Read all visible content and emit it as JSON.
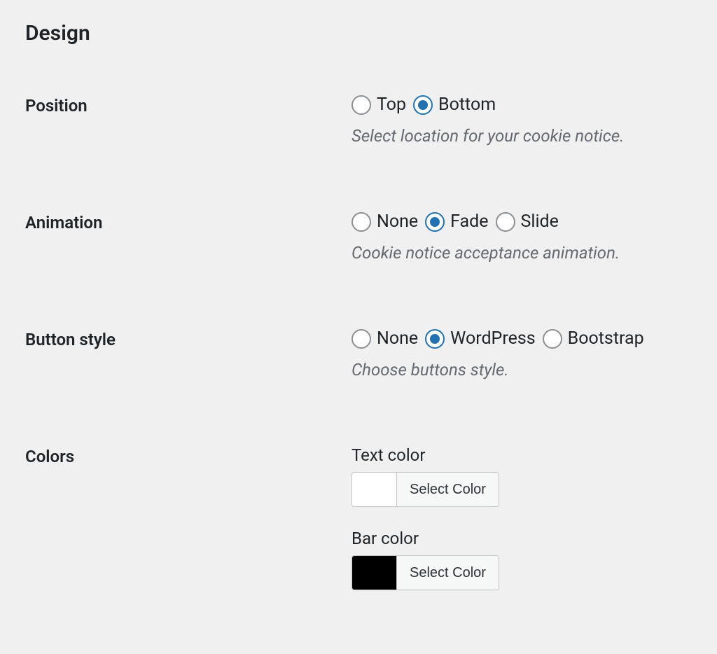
{
  "section": {
    "title": "Design"
  },
  "position": {
    "label": "Position",
    "options": {
      "top": "Top",
      "bottom": "Bottom"
    },
    "description": "Select location for your cookie notice."
  },
  "animation": {
    "label": "Animation",
    "options": {
      "none": "None",
      "fade": "Fade",
      "slide": "Slide"
    },
    "description": "Cookie notice acceptance animation."
  },
  "button_style": {
    "label": "Button style",
    "options": {
      "none": "None",
      "wordpress": "WordPress",
      "bootstrap": "Bootstrap"
    },
    "description": "Choose buttons style."
  },
  "colors": {
    "label": "Colors",
    "text_color": {
      "label": "Text color",
      "value": "#ffffff",
      "button": "Select Color"
    },
    "bar_color": {
      "label": "Bar color",
      "value": "#000000",
      "button": "Select Color"
    }
  }
}
